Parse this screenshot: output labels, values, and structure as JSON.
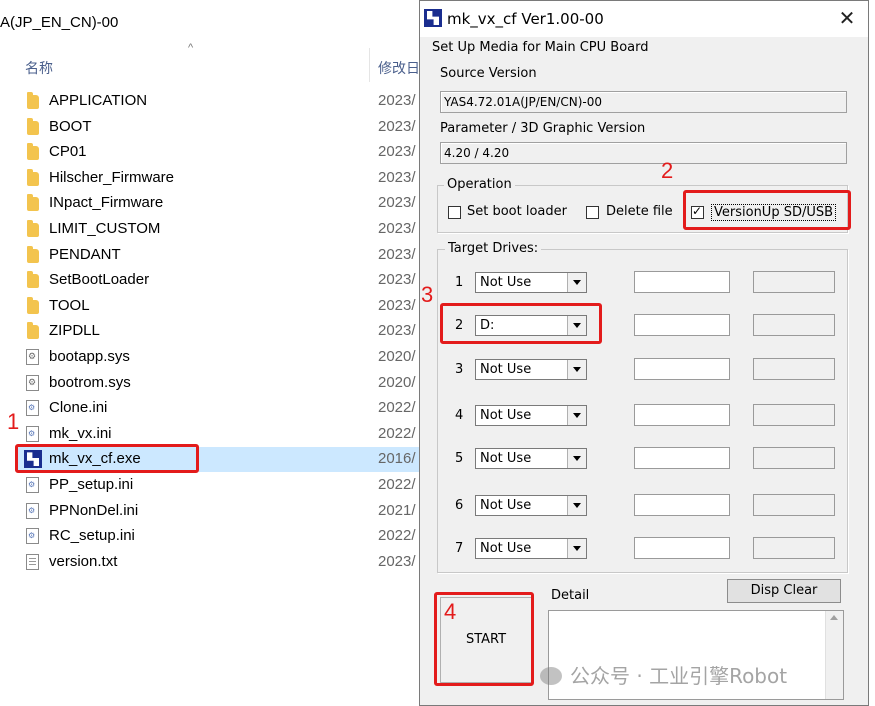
{
  "explorer": {
    "title": "A(JP_EN_CN)-00",
    "col_name": "名称",
    "col_date": "修改日",
    "files": [
      {
        "name": "APPLICATION",
        "date": "2023/",
        "icon": "folder-icon"
      },
      {
        "name": "BOOT",
        "date": "2023/",
        "icon": "folder-icon"
      },
      {
        "name": "CP01",
        "date": "2023/",
        "icon": "folder-icon"
      },
      {
        "name": "Hilscher_Firmware",
        "date": "2023/",
        "icon": "folder-icon"
      },
      {
        "name": "INpact_Firmware",
        "date": "2023/",
        "icon": "folder-icon"
      },
      {
        "name": "LIMIT_CUSTOM",
        "date": "2023/",
        "icon": "folder-icon"
      },
      {
        "name": "PENDANT",
        "date": "2023/",
        "icon": "folder-icon"
      },
      {
        "name": "SetBootLoader",
        "date": "2023/",
        "icon": "folder-icon"
      },
      {
        "name": "TOOL",
        "date": "2023/",
        "icon": "folder-icon"
      },
      {
        "name": "ZIPDLL",
        "date": "2023/",
        "icon": "folder-icon"
      },
      {
        "name": "bootapp.sys",
        "date": "2020/",
        "icon": "system-file-icon"
      },
      {
        "name": "bootrom.sys",
        "date": "2020/",
        "icon": "system-file-icon"
      },
      {
        "name": "Clone.ini",
        "date": "2022/",
        "icon": "settings-file-icon"
      },
      {
        "name": "mk_vx.ini",
        "date": "2022/",
        "icon": "settings-file-icon"
      },
      {
        "name": "mk_vx_cf.exe",
        "date": "2016/",
        "icon": "application-icon"
      },
      {
        "name": "PP_setup.ini",
        "date": "2022/",
        "icon": "settings-file-icon"
      },
      {
        "name": "PPNonDel.ini",
        "date": "2021/",
        "icon": "settings-file-icon"
      },
      {
        "name": "RC_setup.ini",
        "date": "2022/",
        "icon": "settings-file-icon"
      },
      {
        "name": "version.txt",
        "date": "2023/",
        "icon": "text-file-icon"
      }
    ],
    "selected_index": 14
  },
  "dialog": {
    "title": "mk_vx_cf Ver1.00-00",
    "subtitle": "Set Up Media for Main CPU Board",
    "source_version_label": "Source Version",
    "source_version_value": "YAS4.72.01A(JP/EN/CN)-00",
    "param_label": "Parameter / 3D Graphic Version",
    "param_value": "4.20 / 4.20",
    "operation": {
      "title": "Operation",
      "options": [
        {
          "label": "Set boot loader",
          "checked": false
        },
        {
          "label": "Delete file",
          "checked": false
        },
        {
          "label": "VersionUp SD/USB",
          "checked": true
        }
      ]
    },
    "target_drives": {
      "title": "Target Drives:",
      "drives": [
        {
          "num": "1",
          "value": "Not Use"
        },
        {
          "num": "2",
          "value": "D:"
        },
        {
          "num": "3",
          "value": "Not Use"
        },
        {
          "num": "4",
          "value": "Not Use"
        },
        {
          "num": "5",
          "value": "Not Use"
        },
        {
          "num": "6",
          "value": "Not Use"
        },
        {
          "num": "7",
          "value": "Not Use"
        }
      ]
    },
    "disp_clear_label": "Disp Clear",
    "start_label": "START",
    "detail_label": "Detail"
  },
  "annotations": {
    "step1": "1",
    "step2": "2",
    "step3": "3",
    "step4": "4",
    "color": "#e31b1b"
  },
  "watermark": "公众号 · 工业引擎Robot"
}
